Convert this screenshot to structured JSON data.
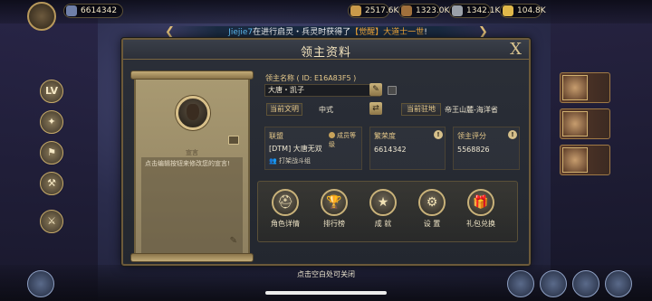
{
  "topbar": {
    "resource_main": "6614342",
    "resources": [
      "2517.6K",
      "1323.0K",
      "1342.1K",
      "104.8K"
    ]
  },
  "banner": {
    "player": "Jiejie7",
    "text_before_item": "在进行启灵・兵灵时获得了",
    "item": "【觉醒】大道士一世",
    "text_after_item": "!"
  },
  "panel": {
    "title": "领主资料",
    "close_label": "X"
  },
  "card": {
    "declaration_label": "宣言",
    "declaration_text": "点击编辑按钮来修改您的宣言!"
  },
  "lord": {
    "name_label": "领主名称 ( ID: E16A83F5 )",
    "name_value": "大唐・凯子",
    "civ_label": "当前文明",
    "civ_value": "中式",
    "station_label": "当前驻地",
    "station_value": "帝王山麓-海洋省"
  },
  "stats": {
    "alliance_label": "联盟",
    "alliance_value": "[DTM] 大唐无双",
    "member_rank_label": "成员等级",
    "team_label": "打架战斗组",
    "prosperity_label": "繁荣度",
    "prosperity_value": "6614342",
    "score_label": "领主评分",
    "score_value": "5568826"
  },
  "actions": [
    {
      "label": "角色详情",
      "icon": "helmet-icon"
    },
    {
      "label": "排行榜",
      "icon": "trophy-icon"
    },
    {
      "label": "成 就",
      "icon": "star-medal-icon"
    },
    {
      "label": "设 置",
      "icon": "gear-icon"
    },
    {
      "label": "礼包兑换",
      "icon": "gift-icon"
    }
  ],
  "close_hint": "点击空白处可关闭"
}
